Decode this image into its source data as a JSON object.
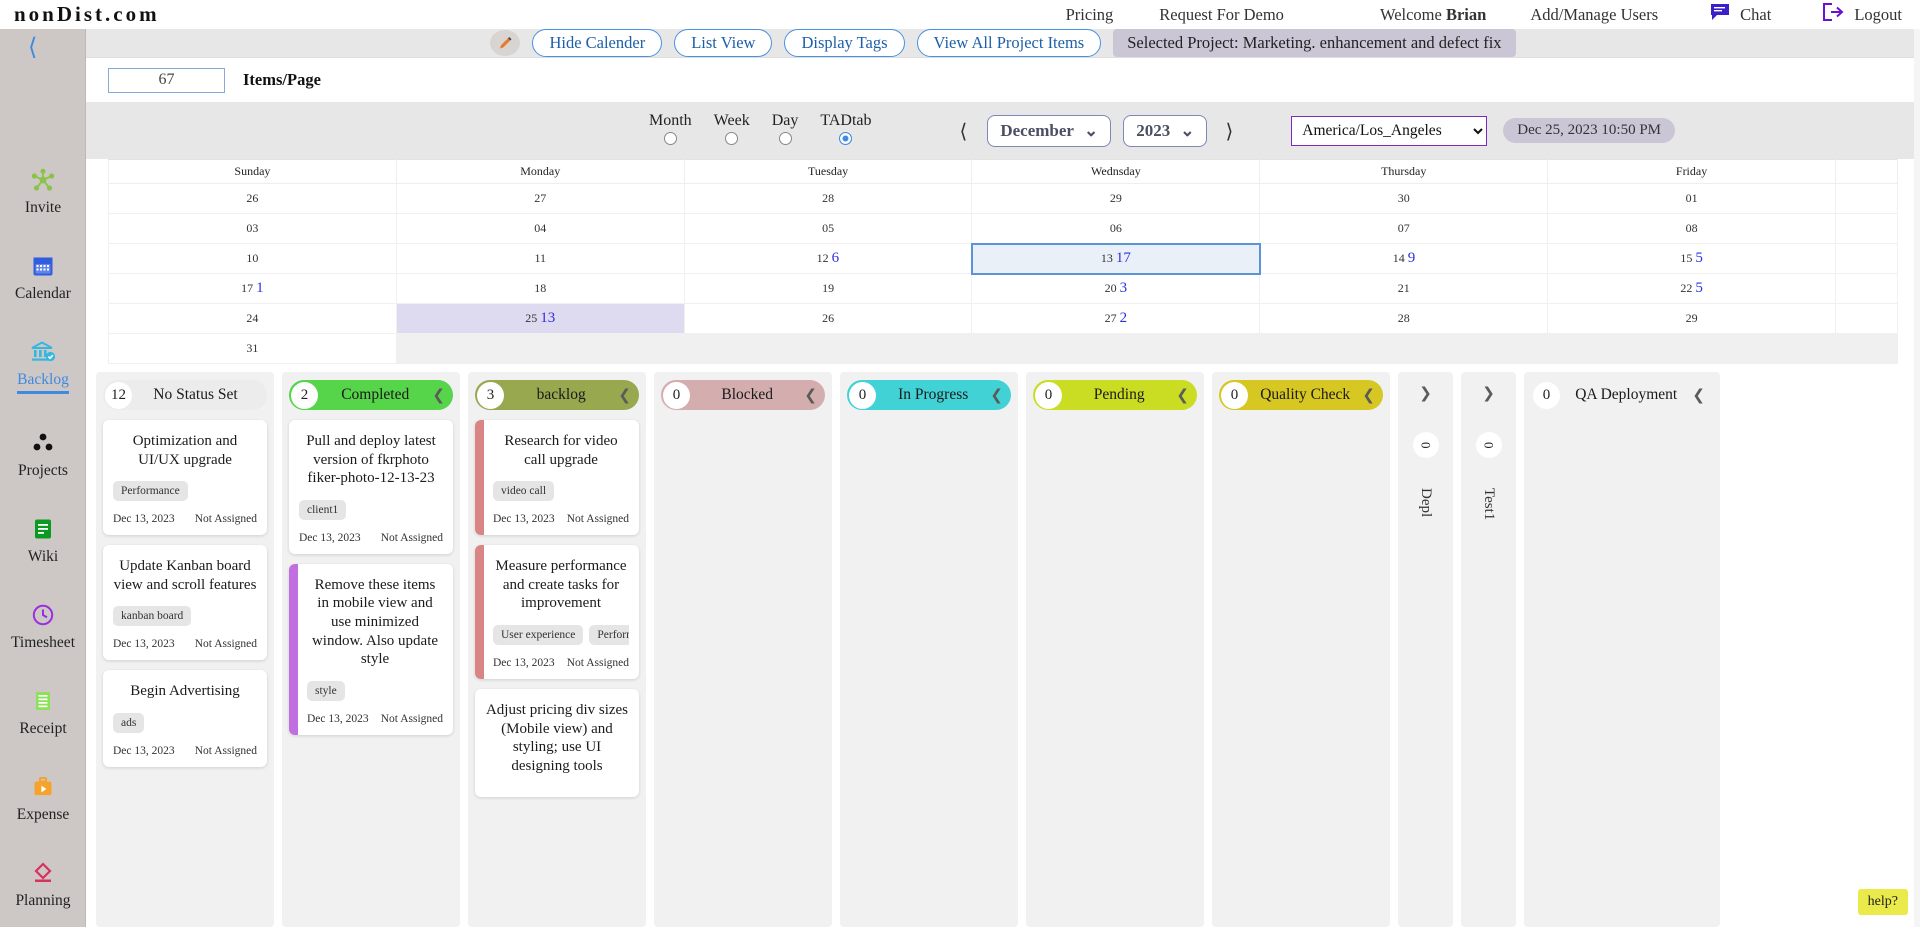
{
  "header": {
    "brand": "nonDist.com",
    "nav": {
      "pricing": "Pricing",
      "request_demo": "Request For Demo",
      "welcome_prefix": "Welcome ",
      "user_name": "Brian",
      "add_manage_users": "Add/Manage Users",
      "chat": "Chat",
      "logout": "Logout"
    }
  },
  "sidebar": {
    "collapse_icon": "chevron-left-icon",
    "items": [
      {
        "label": "Invite",
        "icon": "invite-network-icon",
        "color": "#8bc34a",
        "active": false
      },
      {
        "label": "Calendar",
        "icon": "calendar-icon",
        "color": "#2f5de0",
        "active": false
      },
      {
        "label": "Backlog",
        "icon": "backlog-bank-icon",
        "color": "#35b7e0",
        "active": true
      },
      {
        "label": "Projects",
        "icon": "projects-dots-icon",
        "color": "#111111",
        "active": false
      },
      {
        "label": "Wiki",
        "icon": "wiki-note-icon",
        "color": "#0a9a22",
        "active": false
      },
      {
        "label": "Timesheet",
        "icon": "timesheet-clock-icon",
        "color": "#9b2fe0",
        "active": false
      },
      {
        "label": "Receipt",
        "icon": "receipt-icon",
        "color": "#8ce05a",
        "active": false
      },
      {
        "label": "Expense",
        "icon": "expense-case-icon",
        "color": "#f5a32a",
        "active": false
      },
      {
        "label": "Planning",
        "icon": "planning-icon",
        "color": "#d6325c",
        "active": false
      }
    ]
  },
  "toolbar": {
    "pencil_icon": "pencil-edit-icon",
    "hide_calendar": "Hide Calender",
    "list_view": "List View",
    "display_tags": "Display Tags",
    "view_all_project_items": "View All Project Items",
    "selected_project": "Selected Project: Marketing. enhancement and defect fix"
  },
  "items_per_page": {
    "value": "67",
    "placeholder": "67",
    "label": "Items/Page"
  },
  "calendar_controls": {
    "view_modes": [
      {
        "label": "Month",
        "selected": false
      },
      {
        "label": "Week",
        "selected": false
      },
      {
        "label": "Day",
        "selected": false
      },
      {
        "label": "TADtab",
        "selected": true
      }
    ],
    "prev_icon": "chevron-left-icon",
    "next_icon": "chevron-right-icon",
    "month": "December",
    "year": "2023",
    "timezone": "America/Los_Angeles",
    "timezone_options": [
      "America/Los_Angeles"
    ],
    "clock": "Dec 25, 2023 10:50 PM"
  },
  "calendar": {
    "day_headers": [
      "Sunday",
      "Monday",
      "Tuesday",
      "Wednsday",
      "Thursday",
      "Friday",
      ""
    ],
    "weeks": [
      [
        {
          "day": "26",
          "count": "",
          "state": ""
        },
        {
          "day": "27",
          "count": "",
          "state": ""
        },
        {
          "day": "28",
          "count": "",
          "state": ""
        },
        {
          "day": "29",
          "count": "",
          "state": ""
        },
        {
          "day": "30",
          "count": "",
          "state": ""
        },
        {
          "day": "01",
          "count": "",
          "state": ""
        },
        {
          "day": "",
          "count": "",
          "state": ""
        }
      ],
      [
        {
          "day": "03",
          "count": "",
          "state": ""
        },
        {
          "day": "04",
          "count": "",
          "state": ""
        },
        {
          "day": "05",
          "count": "",
          "state": ""
        },
        {
          "day": "06",
          "count": "",
          "state": ""
        },
        {
          "day": "07",
          "count": "",
          "state": ""
        },
        {
          "day": "08",
          "count": "",
          "state": ""
        },
        {
          "day": "",
          "count": "",
          "state": ""
        }
      ],
      [
        {
          "day": "10",
          "count": "",
          "state": ""
        },
        {
          "day": "11",
          "count": "",
          "state": ""
        },
        {
          "day": "12",
          "count": "6",
          "state": ""
        },
        {
          "day": "13",
          "count": "17",
          "state": "selected"
        },
        {
          "day": "14",
          "count": "9",
          "state": ""
        },
        {
          "day": "15",
          "count": "5",
          "state": ""
        },
        {
          "day": "",
          "count": "",
          "state": ""
        }
      ],
      [
        {
          "day": "17",
          "count": "1",
          "state": ""
        },
        {
          "day": "18",
          "count": "",
          "state": ""
        },
        {
          "day": "19",
          "count": "",
          "state": ""
        },
        {
          "day": "20",
          "count": "3",
          "state": ""
        },
        {
          "day": "21",
          "count": "",
          "state": ""
        },
        {
          "day": "22",
          "count": "5",
          "state": ""
        },
        {
          "day": "",
          "count": "",
          "state": ""
        }
      ],
      [
        {
          "day": "24",
          "count": "",
          "state": ""
        },
        {
          "day": "25",
          "count": "13",
          "state": "highlight"
        },
        {
          "day": "26",
          "count": "",
          "state": ""
        },
        {
          "day": "27",
          "count": "2",
          "state": ""
        },
        {
          "day": "28",
          "count": "",
          "state": ""
        },
        {
          "day": "29",
          "count": "",
          "state": ""
        },
        {
          "day": "",
          "count": "",
          "state": ""
        }
      ],
      [
        {
          "day": "31",
          "count": "",
          "state": ""
        },
        {
          "day": "",
          "count": "",
          "state": "empty"
        },
        {
          "day": "",
          "count": "",
          "state": "empty"
        },
        {
          "day": "",
          "count": "",
          "state": "empty"
        },
        {
          "day": "",
          "count": "",
          "state": "empty"
        },
        {
          "day": "",
          "count": "",
          "state": "empty"
        },
        {
          "day": "",
          "count": "",
          "state": "empty"
        }
      ]
    ]
  },
  "kanban": {
    "columns": [
      {
        "title": "No Status Set",
        "count": "12",
        "header_color": "#ececec",
        "collapsed": false,
        "has_chevron": false,
        "chevron_icon": "chevron-left-icon",
        "cards": [
          {
            "title": "Optimization and UI/UX upgrade",
            "tags": [
              "Performance"
            ],
            "date": "Dec 13, 2023",
            "assignee": "Not Assigned",
            "stripe": ""
          },
          {
            "title": "Update Kanban board view and scroll features",
            "tags": [
              "kanban board"
            ],
            "date": "Dec 13, 2023",
            "assignee": "Not Assigned",
            "stripe": ""
          },
          {
            "title": "Begin Advertising",
            "tags": [
              "ads"
            ],
            "date": "Dec 13, 2023",
            "assignee": "Not Assigned",
            "stripe": ""
          }
        ]
      },
      {
        "title": "Completed",
        "count": "2",
        "header_color": "#56d44a",
        "collapsed": false,
        "has_chevron": true,
        "chevron_icon": "chevron-left-icon",
        "cards": [
          {
            "title": "Pull and deploy latest version of fkrphoto fiker-photo-12-13-23",
            "tags": [
              "client1"
            ],
            "date": "Dec 13, 2023",
            "assignee": "Not Assigned",
            "stripe": ""
          },
          {
            "title": "Remove these items in mobile view and use minimized window. Also update style",
            "tags": [
              "style"
            ],
            "date": "Dec 13, 2023",
            "assignee": "Not Assigned",
            "stripe": "#c06ee0"
          }
        ]
      },
      {
        "title": "backlog",
        "count": "3",
        "header_color": "#97a84f",
        "collapsed": false,
        "has_chevron": true,
        "chevron_icon": "chevron-left-icon",
        "cards": [
          {
            "title": "Research for video call upgrade",
            "tags": [
              "video call"
            ],
            "date": "Dec 13, 2023",
            "assignee": "Not Assigned",
            "stripe": "#d98585"
          },
          {
            "title": "Measure performance and create tasks for improvement",
            "tags": [
              "User experience",
              "Performance"
            ],
            "date": "Dec 13, 2023",
            "assignee": "Not Assigned",
            "stripe": "#d98585"
          },
          {
            "title": "Adjust pricing div sizes (Mobile view) and styling; use UI designing tools",
            "tags": [],
            "date": "",
            "assignee": "",
            "stripe": ""
          }
        ]
      },
      {
        "title": "Blocked",
        "count": "0",
        "header_color": "#d4aeae",
        "collapsed": false,
        "has_chevron": true,
        "chevron_icon": "chevron-left-icon",
        "cards": []
      },
      {
        "title": "In Progress",
        "count": "0",
        "header_color": "#41d2d6",
        "collapsed": false,
        "has_chevron": true,
        "chevron_icon": "chevron-left-icon",
        "cards": []
      },
      {
        "title": "Pending",
        "count": "0",
        "header_color": "#cbdd22",
        "collapsed": false,
        "has_chevron": true,
        "chevron_icon": "chevron-left-icon",
        "cards": []
      },
      {
        "title": "Quality Check",
        "count": "0",
        "header_color": "#d6c723",
        "collapsed": false,
        "has_chevron": true,
        "chevron_icon": "chevron-left-icon",
        "cards": []
      },
      {
        "title": "Depl",
        "count": "0",
        "header_color": "#f1f1f1",
        "collapsed": true,
        "has_chevron": true,
        "chevron_icon": "chevron-right-icon",
        "cards": []
      },
      {
        "title": "Test1",
        "count": "0",
        "header_color": "#f1f1f1",
        "collapsed": true,
        "has_chevron": true,
        "chevron_icon": "chevron-right-icon",
        "cards": []
      },
      {
        "title": "QA Deployment",
        "count": "0",
        "header_color": "#f1f1f1",
        "collapsed": false,
        "has_chevron": true,
        "chevron_icon": "chevron-left-icon",
        "cards": []
      }
    ]
  },
  "help": {
    "label": "help?"
  }
}
